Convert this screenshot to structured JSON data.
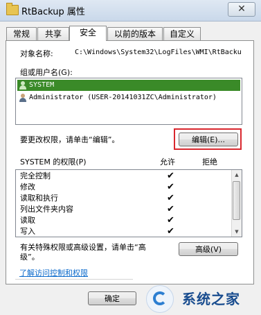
{
  "window": {
    "title": "RtBackup 属性",
    "close_glyph": "✕"
  },
  "tabs": [
    {
      "label": "常规"
    },
    {
      "label": "共享"
    },
    {
      "label": "安全"
    },
    {
      "label": "以前的版本"
    },
    {
      "label": "自定义"
    }
  ],
  "security": {
    "object_label": "对象名称:",
    "object_path": "C:\\Windows\\System32\\LogFiles\\WMI\\RtBacku",
    "group_label": "组或用户名(G):",
    "users": [
      {
        "name": "SYSTEM"
      },
      {
        "name": "Administrator (USER-20141031ZC\\Administrator)"
      }
    ],
    "change_text": "要更改权限，请单击“编辑”。",
    "edit_button": "编辑(E)...",
    "perm_label": "SYSTEM 的权限(P)",
    "allow_header": "允许",
    "deny_header": "拒绝",
    "permissions": [
      {
        "name": "完全控制",
        "allow": "✔"
      },
      {
        "name": "修改",
        "allow": "✔"
      },
      {
        "name": "读取和执行",
        "allow": "✔"
      },
      {
        "name": "列出文件夹内容",
        "allow": "✔"
      },
      {
        "name": "读取",
        "allow": "✔"
      },
      {
        "name": "写入",
        "allow": "✔"
      }
    ],
    "special_text_1": "有关特殊权限或高级设置，请单击“高",
    "special_text_2": "级”。",
    "advanced_button": "高级(V)",
    "help_link": "了解访问控制和权限"
  },
  "footer": {
    "ok_button": "确定"
  },
  "watermark": {
    "text": "系统之家"
  },
  "colors": {
    "selection": "#3a8a28",
    "highlight_border": "#d9272e",
    "link": "#0b6acb"
  }
}
